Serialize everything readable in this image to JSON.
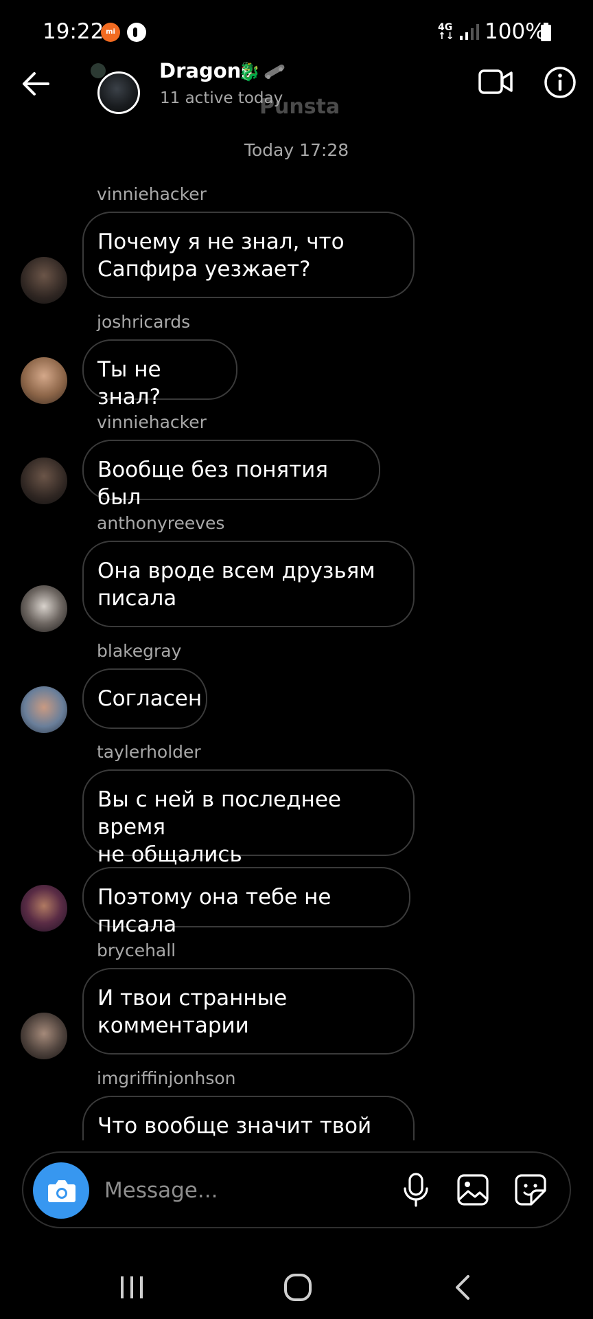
{
  "status_bar": {
    "time": "19:22",
    "network": "4G",
    "battery": "100%"
  },
  "header": {
    "title": "Dragons",
    "title_emoji": "🐉",
    "subtitle": "11 active today",
    "watermark": "Punsta"
  },
  "conversation": {
    "timestamp": "Today 17:28",
    "messages": [
      {
        "username": "vinniehacker",
        "lines": [
          "Почему я не знал, что",
          "Сапфира уезжает?"
        ]
      },
      {
        "username": "joshricards",
        "lines": [
          "Ты не знал?"
        ]
      },
      {
        "username": "vinniehacker",
        "lines": [
          "Вообще без понятия был"
        ]
      },
      {
        "username": "anthonyreeves",
        "lines": [
          "Она вроде  всем друзьям",
          "писала"
        ]
      },
      {
        "username": "blakegray",
        "lines": [
          "Согласен"
        ]
      },
      {
        "username": "taylerholder",
        "lines": [
          "Вы с ней в последнее время",
          "не общались"
        ]
      },
      {
        "username": "",
        "lines": [
          "Поэтому она тебе не писала"
        ]
      },
      {
        "username": "brycehall",
        "lines": [
          "И твои странные",
          "комментарии"
        ]
      },
      {
        "username": "imgriffinjonhson",
        "lines": [
          "Что вообще значит твой"
        ]
      }
    ]
  },
  "composer": {
    "placeholder": "Message..."
  },
  "colors": {
    "background": "#000000",
    "bubble_border": "#3a3a3a",
    "secondary_text": "#a8a8a8",
    "camera_button": "#3797f0"
  }
}
